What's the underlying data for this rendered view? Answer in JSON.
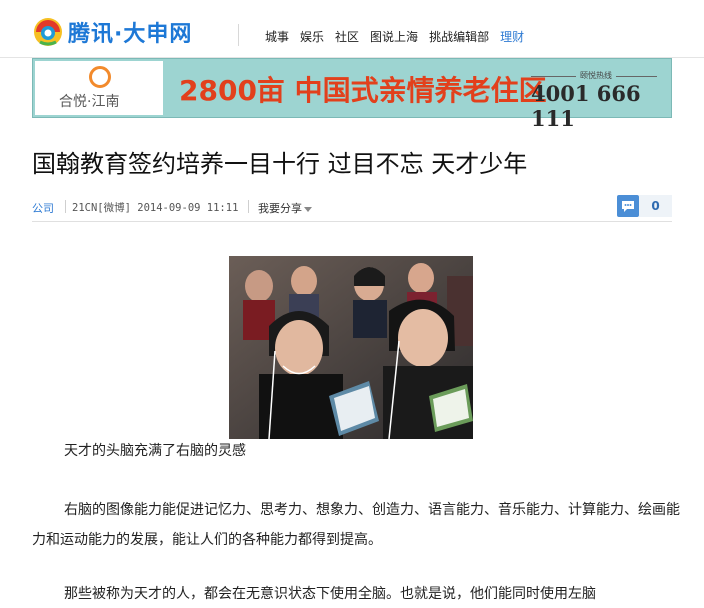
{
  "header": {
    "logo_text": "腾讯·大申网",
    "nav": [
      "城事",
      "娱乐",
      "社区",
      "图说上海",
      "挑战编辑部",
      "理财"
    ],
    "active_nav": "理财"
  },
  "banner": {
    "brand": "合悦·江南",
    "headline": "2800亩 中国式亲情养老住区",
    "hotline_label": "颐悦热线",
    "hotline_number": "4001 666 111"
  },
  "article": {
    "title": "国翰教育签约培养一目十行 过目不忘 天才少年",
    "category": "公司",
    "source": "21CN[微博] 2014-09-09 11:11",
    "share_label": "我要分享",
    "comment_count": "0",
    "caption": "天才的头脑充满了右脑的灵感",
    "paragraphs": [
      "右脑的图像能力能促进记忆力、思考力、想象力、创造力、语言能力、音乐能力、计算能力、绘画能力和运动能力的发展，能让人们的各种能力都得到提高。",
      "那些被称为天才的人，都会在无意识状态下使用全脑。也就是说，他们能同时使用左脑"
    ]
  },
  "colors": {
    "link_blue": "#2f7bd3",
    "banner_bg": "#9dd4d1",
    "banner_red": "#e2401c"
  }
}
